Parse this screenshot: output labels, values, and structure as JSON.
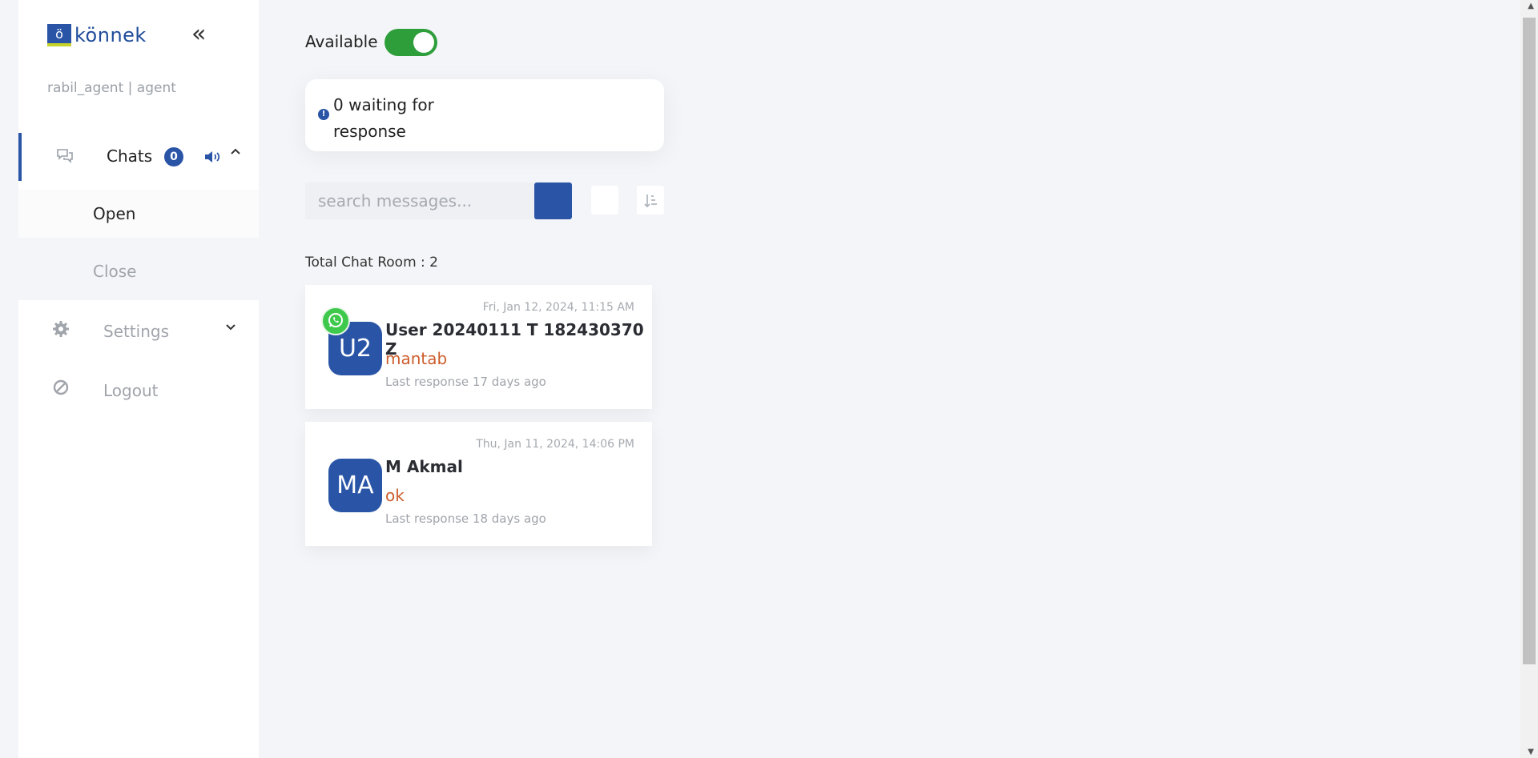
{
  "brand": {
    "logo_letter": "ö",
    "name": "könnek"
  },
  "sidebar": {
    "collapse_label": "«",
    "user_line": "rabil_agent | agent",
    "chats": {
      "label": "Chats",
      "count": "0"
    },
    "open_label": "Open",
    "close_label": "Close",
    "settings_label": "Settings",
    "logout_label": "Logout"
  },
  "main": {
    "availability_label": "Available",
    "availability_on": true,
    "waiting_text": "0 waiting for response",
    "search_placeholder": "search messages...",
    "total_rooms": "Total Chat Room : 2",
    "chats": [
      {
        "date": "Fri, Jan 12, 2024, 11:15 AM",
        "initials": "U2",
        "name": "User 20240111 T 182430370 Z",
        "message": "mantab",
        "last_response": "Last response 17 days ago",
        "channel_icon": "whatsapp-icon"
      },
      {
        "date": "Thu, Jan 11, 2024, 14:06 PM",
        "initials": "MA",
        "name": "M Akmal",
        "message": "ok",
        "last_response": "Last response 18 days ago"
      }
    ]
  },
  "colors": {
    "accent": "#2a55a7",
    "toggle_on": "#2e9e3b",
    "message": "#cc5d2c",
    "whatsapp": "#3ec94c"
  }
}
